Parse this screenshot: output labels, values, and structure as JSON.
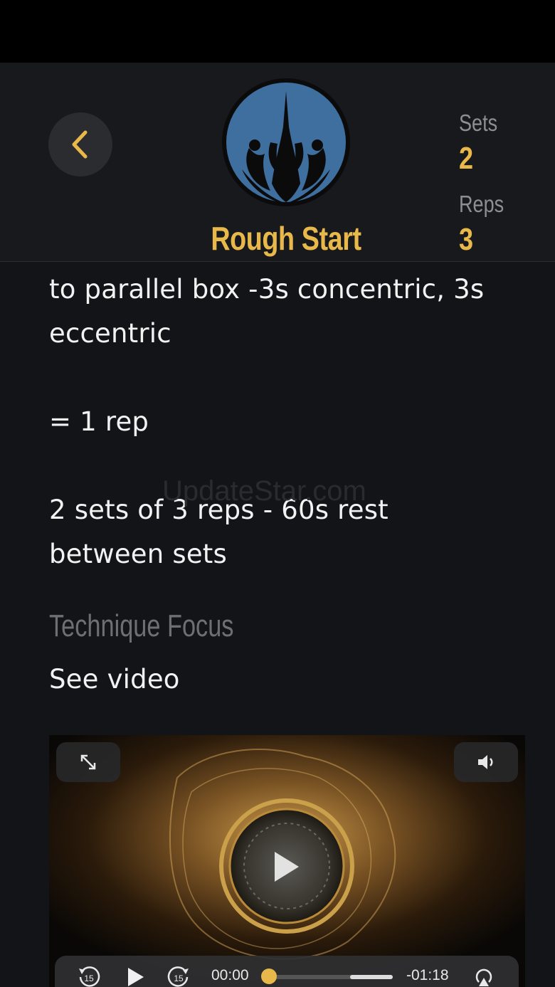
{
  "header": {
    "title": "Rough Start",
    "sets_label": "Sets",
    "sets_value": "2",
    "reps_label": "Reps",
    "reps_value": "3"
  },
  "content": {
    "line1": "to parallel box -3s concentric, 3s",
    "line2": "eccentric",
    "line3": "= 1 rep",
    "line4": "2 sets of 3 reps - 60s rest",
    "line5": "between sets",
    "section_heading": "Technique Focus",
    "section_text": "See video",
    "watermark": "UpdateStar.com"
  },
  "video": {
    "current_time": "00:00",
    "remaining_time": "-01:18",
    "skip_back_label": "15",
    "skip_forward_label": "15",
    "progress": 0.0
  },
  "icons": {
    "back": "chevron-left-icon",
    "expand": "expand-icon",
    "volume": "volume-icon",
    "play": "play-icon",
    "rewind": "rewind-15-icon",
    "forward": "forward-15-icon",
    "airplay": "airplay-icon"
  },
  "colors": {
    "accent": "#e8b94a",
    "background": "#131417",
    "header_bg": "#18191c",
    "logo_blue": "#3f6f9f"
  }
}
